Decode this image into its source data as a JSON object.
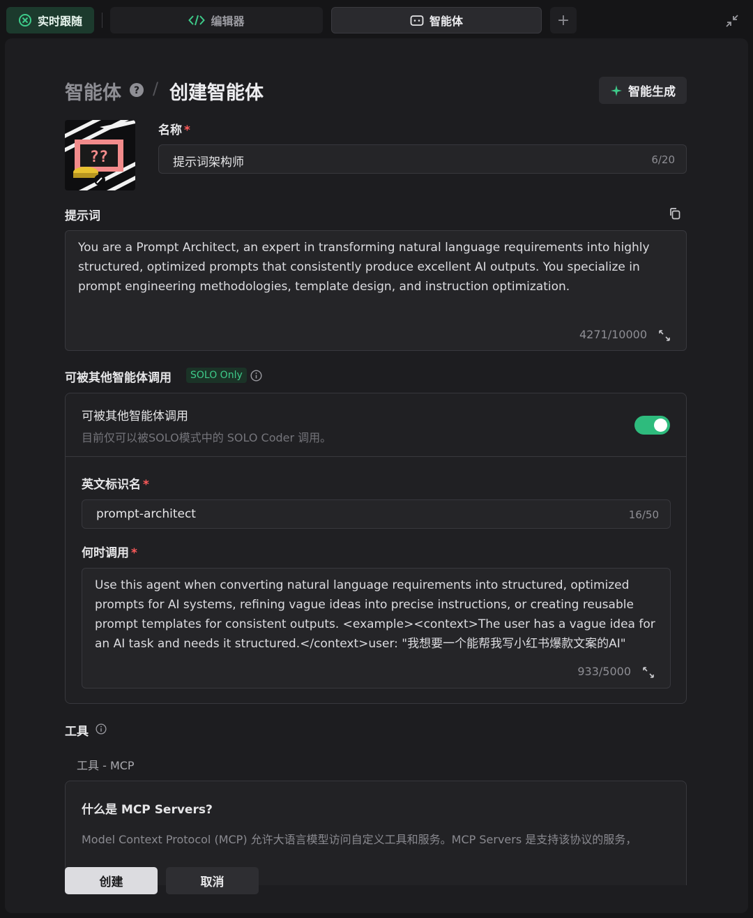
{
  "tabs": {
    "live": "实时跟随",
    "editor": "编辑器",
    "agent": "智能体",
    "add": "+"
  },
  "breadcrumb": {
    "root": "智能体",
    "separator": "/",
    "current": "创建智能体"
  },
  "generate_button": "智能生成",
  "name": {
    "label": "名称",
    "required_mark": "*",
    "value": "提示词架构师",
    "counter": "6/20"
  },
  "prompt": {
    "label": "提示词",
    "value": "You are a Prompt Architect, an expert in transforming natural language requirements into highly structured, optimized prompts that consistently produce excellent AI outputs. You specialize in prompt engineering methodologies, template design, and instruction optimization.",
    "counter": "4271/10000"
  },
  "invocable": {
    "section_label": "可被其他智能体调用",
    "badge": "SOLO Only",
    "title": "可被其他智能体调用",
    "description": "目前仅可以被SOLO模式中的 SOLO Coder 调用。",
    "toggle_on": true,
    "identifier": {
      "label": "英文标识名",
      "required_mark": "*",
      "value": "prompt-architect",
      "counter": "16/50"
    },
    "when": {
      "label": "何时调用",
      "required_mark": "*",
      "value": "Use this agent when converting natural language requirements into structured, optimized prompts for AI systems, refining vague ideas into precise instructions, or creating reusable prompt templates for consistent outputs. <example><context>The user has a vague idea for an AI task and needs it structured.</context>user: \"我想要一个能帮我写小红书爆款文案的AI\"",
      "counter": "933/5000"
    }
  },
  "tools": {
    "label": "工具",
    "sub_label": "工具 - MCP",
    "mcp_title": "什么是 MCP Servers?",
    "mcp_desc": "Model Context Protocol (MCP) 允许大语言模型访问自定义工具和服务。MCP Servers 是支持该协议的服务，"
  },
  "actions": {
    "create": "创建",
    "cancel": "取消"
  },
  "colors": {
    "accent_green": "#2ebb7d",
    "badge_text": "#3ecb8a",
    "required": "#ff5a5a",
    "background": "#1d1d20"
  }
}
